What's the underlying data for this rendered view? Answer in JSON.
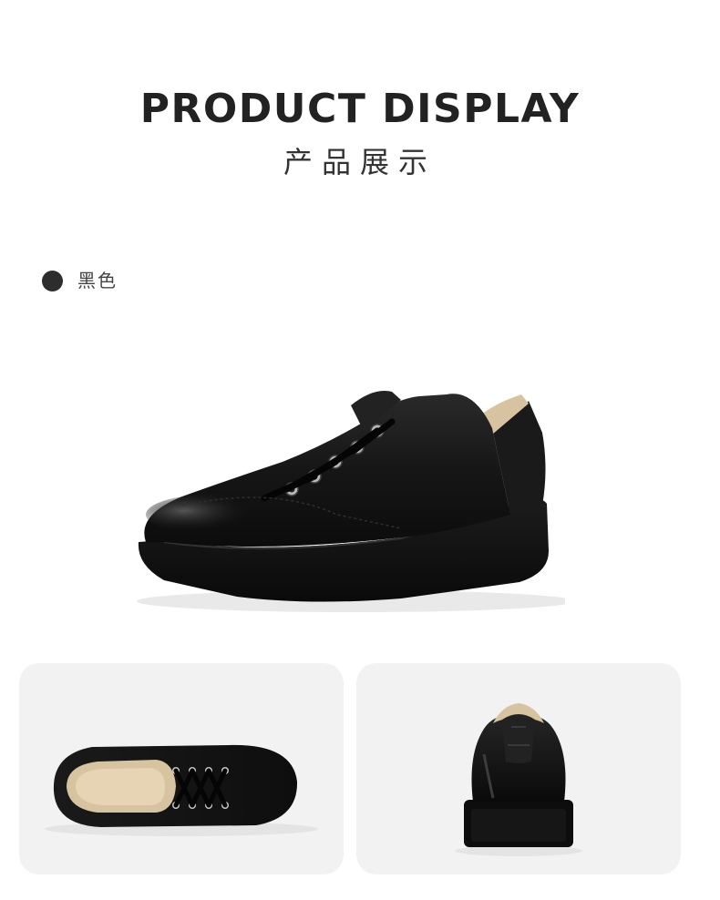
{
  "header": {
    "title": "PRODUCT DISPLAY",
    "subtitle": "产品展示"
  },
  "color_option": {
    "label": "黑色",
    "swatch_color": "#2d2d2d"
  },
  "images": {
    "hero": "black-leather-sneaker-side-view",
    "detail_left": "black-sneaker-top-view",
    "detail_right": "black-sneaker-back-view"
  },
  "colors": {
    "card_background": "#f2f2f2",
    "shoe_black": "#141414",
    "lining_beige": "#d8c3a0"
  }
}
